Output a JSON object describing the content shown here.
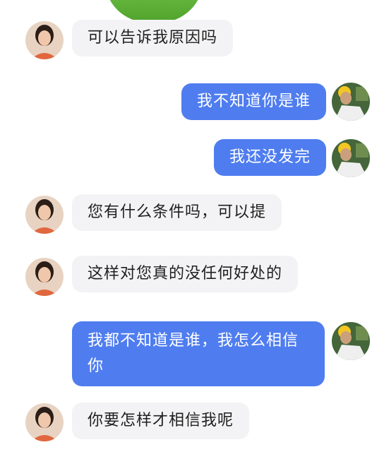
{
  "messages": [
    {
      "side": "left",
      "text": "可以告诉我原因吗"
    },
    {
      "side": "right",
      "text": "我不知道你是谁"
    },
    {
      "side": "right",
      "text": "我还没发完"
    },
    {
      "side": "left",
      "text": "您有什么条件吗，可以提"
    },
    {
      "side": "left",
      "text": "这样对您真的没任何好处的"
    },
    {
      "side": "right",
      "text": "我都不知道是谁，我怎么相信你"
    },
    {
      "side": "left",
      "text": "你要怎样才相信我呢"
    }
  ],
  "colors": {
    "outgoing_bubble": "#4f7df0",
    "incoming_bubble": "#f3f3f5",
    "background": "#ffffff"
  }
}
